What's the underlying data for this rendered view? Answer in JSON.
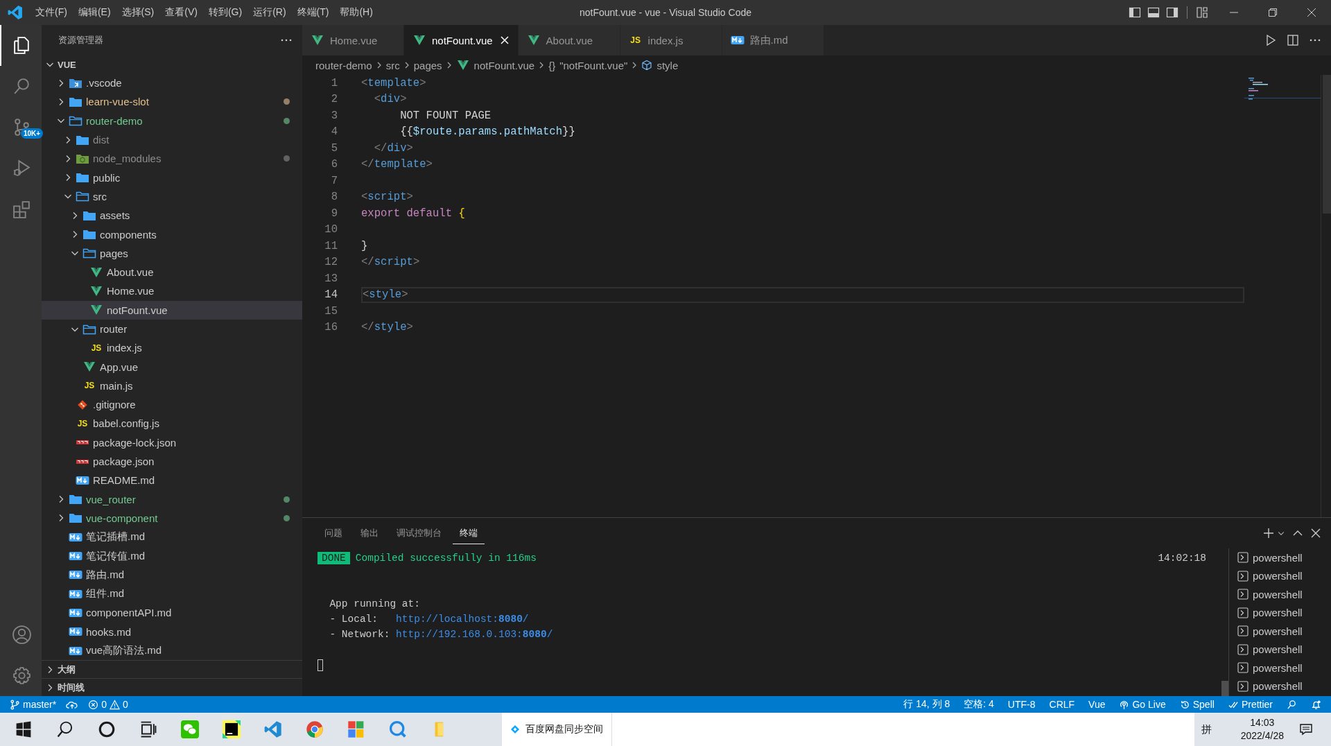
{
  "title_bar": {
    "menus": [
      "文件(F)",
      "编辑(E)",
      "选择(S)",
      "查看(V)",
      "转到(G)",
      "运行(R)",
      "终端(T)",
      "帮助(H)"
    ],
    "title": "notFount.vue - vue - Visual Studio Code"
  },
  "activity_bar": {
    "items": [
      {
        "kind": "explorer",
        "selected": true
      },
      {
        "kind": "search",
        "selected": false
      },
      {
        "kind": "source-control",
        "selected": false,
        "badge": "10K+"
      },
      {
        "kind": "run",
        "selected": false
      },
      {
        "kind": "extensions",
        "selected": false
      }
    ],
    "bottom": [
      {
        "kind": "account"
      },
      {
        "kind": "settings"
      }
    ]
  },
  "explorer": {
    "title": "资源管理器",
    "root": {
      "label": "VUE",
      "expanded": true
    },
    "tree": [
      {
        "name": ".vscode",
        "kind": "vscode-folder",
        "expanded": false,
        "selected": false
      },
      {
        "name": "learn-vue-slot",
        "kind": "folder",
        "expanded": false,
        "selected": false,
        "color": "#e2c08d",
        "dot": true
      },
      {
        "name": "router-demo",
        "kind": "folder",
        "expanded": true,
        "selected": false,
        "color": "#73c991",
        "dot": true,
        "children": [
          {
            "name": "dist",
            "kind": "folder",
            "expanded": false,
            "selected": false,
            "color": "#8c8c8c",
            "dot": false
          },
          {
            "name": "node_modules",
            "kind": "node-folder",
            "expanded": false,
            "selected": false,
            "color": "#8c8c8c",
            "dot": true
          },
          {
            "name": "public",
            "kind": "folder",
            "expanded": false,
            "selected": false
          },
          {
            "name": "src",
            "kind": "folder",
            "expanded": true,
            "selected": false,
            "children": [
              {
                "name": "assets",
                "kind": "folder",
                "expanded": false,
                "selected": false
              },
              {
                "name": "components",
                "kind": "folder",
                "expanded": false,
                "selected": false
              },
              {
                "name": "pages",
                "kind": "folder",
                "expanded": true,
                "selected": false,
                "children": [
                  {
                    "name": "About.vue",
                    "kind": "vue",
                    "selected": false
                  },
                  {
                    "name": "Home.vue",
                    "kind": "vue",
                    "selected": false
                  },
                  {
                    "name": "notFount.vue",
                    "kind": "vue",
                    "selected": true
                  }
                ]
              },
              {
                "name": "router",
                "kind": "folder",
                "expanded": true,
                "selected": false,
                "children": [
                  {
                    "name": "index.js",
                    "kind": "js",
                    "icon_label": "JS",
                    "selected": false
                  }
                ]
              },
              {
                "name": "App.vue",
                "kind": "vue",
                "selected": false
              },
              {
                "name": "main.js",
                "kind": "js",
                "icon_label": "JS",
                "selected": false
              }
            ]
          },
          {
            "name": ".gitignore",
            "kind": "git",
            "selected": false
          },
          {
            "name": "babel.config.js",
            "kind": "js",
            "icon_label": "JS",
            "selected": false
          },
          {
            "name": "package-lock.json",
            "kind": "npm",
            "selected": false
          },
          {
            "name": "package.json",
            "kind": "npm",
            "selected": false
          },
          {
            "name": "README.md",
            "kind": "md",
            "selected": false
          }
        ]
      },
      {
        "name": "vue_router",
        "kind": "folder",
        "expanded": false,
        "selected": false,
        "color": "#73c991",
        "dot": true
      },
      {
        "name": "vue-component",
        "kind": "folder",
        "expanded": false,
        "selected": false,
        "color": "#73c991",
        "dot": true
      },
      {
        "name": "笔记插槽.md",
        "kind": "md",
        "selected": false
      },
      {
        "name": "笔记传值.md",
        "kind": "md",
        "selected": false
      },
      {
        "name": "路由.md",
        "kind": "md",
        "selected": false
      },
      {
        "name": "组件.md",
        "kind": "md",
        "selected": false
      },
      {
        "name": "componentAPI.md",
        "kind": "md",
        "selected": false
      },
      {
        "name": "hooks.md",
        "kind": "md",
        "selected": false
      },
      {
        "name": "vue高阶语法.md",
        "kind": "md",
        "selected": false
      }
    ],
    "sections": [
      {
        "label": "大纲",
        "expanded": false
      },
      {
        "label": "时间线",
        "expanded": false
      }
    ]
  },
  "editor": {
    "tabs": [
      {
        "label": "Home.vue",
        "kind": "vue",
        "selected": false
      },
      {
        "label": "notFount.vue",
        "kind": "vue",
        "selected": true
      },
      {
        "label": "About.vue",
        "kind": "vue",
        "selected": false
      },
      {
        "label": "index.js",
        "kind": "js",
        "icon_label": "JS",
        "selected": false
      },
      {
        "label": "路由.md",
        "kind": "md",
        "selected": false
      }
    ],
    "breadcrumb": [
      {
        "kind": "folder",
        "text": "router-demo"
      },
      {
        "kind": "folder",
        "text": "src"
      },
      {
        "kind": "folder",
        "text": "pages"
      },
      {
        "kind": "file",
        "text": "notFount.vue"
      },
      {
        "kind": "object",
        "symbol": "{}",
        "text": "\"notFount.vue\""
      },
      {
        "kind": "element",
        "text": "style"
      }
    ],
    "lines": [
      {
        "number": "1",
        "current": false,
        "tokens": [
          {
            "kind": "punct",
            "text": "<"
          },
          {
            "kind": "tag",
            "text": "template"
          },
          {
            "kind": "punct",
            "text": ">"
          }
        ]
      },
      {
        "number": "2",
        "current": false,
        "tokens": [
          {
            "kind": "punct",
            "text": "  <"
          },
          {
            "kind": "tag",
            "text": "div"
          },
          {
            "kind": "punct",
            "text": ">"
          }
        ]
      },
      {
        "number": "3",
        "current": false,
        "tokens": [
          {
            "kind": "text",
            "text": "      NOT FOUNT PAGE"
          }
        ]
      },
      {
        "number": "4",
        "current": false,
        "tokens": [
          {
            "kind": "text",
            "text": "      {{"
          },
          {
            "kind": "variable",
            "text": "$route.params.pathMatch"
          },
          {
            "kind": "text",
            "text": "}}"
          }
        ]
      },
      {
        "number": "5",
        "current": false,
        "tokens": [
          {
            "kind": "punct",
            "text": "  </"
          },
          {
            "kind": "tag",
            "text": "div"
          },
          {
            "kind": "punct",
            "text": ">"
          }
        ]
      },
      {
        "number": "6",
        "current": false,
        "tokens": [
          {
            "kind": "punct",
            "text": "</"
          },
          {
            "kind": "tag",
            "text": "template"
          },
          {
            "kind": "punct",
            "text": ">"
          }
        ]
      },
      {
        "number": "7",
        "current": false
      },
      {
        "number": "8",
        "current": false,
        "tokens": [
          {
            "kind": "punct",
            "text": "<"
          },
          {
            "kind": "tag",
            "text": "script"
          },
          {
            "kind": "punct",
            "text": ">"
          }
        ]
      },
      {
        "number": "9",
        "current": false,
        "tokens": [
          {
            "kind": "keyword",
            "text": "export default "
          },
          {
            "kind": "bracket",
            "text": "{"
          }
        ]
      },
      {
        "number": "10",
        "current": false
      },
      {
        "number": "11",
        "current": false,
        "tokens": [
          {
            "kind": "text",
            "text": "}"
          }
        ]
      },
      {
        "number": "12",
        "current": false,
        "tokens": [
          {
            "kind": "punct",
            "text": "</"
          },
          {
            "kind": "tag",
            "text": "script"
          },
          {
            "kind": "punct",
            "text": ">"
          }
        ]
      },
      {
        "number": "13",
        "current": false
      },
      {
        "number": "14",
        "current": true,
        "tokens": [
          {
            "kind": "punct",
            "text": "<"
          },
          {
            "kind": "tag",
            "text": "style"
          },
          {
            "kind": "punct",
            "text": ">"
          }
        ]
      },
      {
        "number": "15",
        "current": false
      },
      {
        "number": "16",
        "current": false,
        "tokens": [
          {
            "kind": "punct",
            "text": "</"
          },
          {
            "kind": "tag",
            "text": "style"
          },
          {
            "kind": "punct",
            "text": ">"
          }
        ]
      }
    ]
  },
  "panel": {
    "tabs": [
      {
        "label": "问题",
        "selected": false
      },
      {
        "label": "输出",
        "selected": false
      },
      {
        "label": "调试控制台",
        "selected": false
      },
      {
        "label": "终端",
        "selected": true
      }
    ],
    "terminal": [
      {
        "kind": "status",
        "badge": "DONE",
        "text": "Compiled successfully in 116ms",
        "time": "14:02:18"
      },
      {
        "kind": "blank"
      },
      {
        "kind": "blank"
      },
      {
        "kind": "text",
        "text": "App running at:"
      },
      {
        "kind": "url",
        "label": "- Local:",
        "url": "http://localhost:**8080**/"
      },
      {
        "kind": "url",
        "label": "- Network:",
        "url": "http://192.168.0.103:**8080**/"
      },
      {
        "kind": "blank"
      },
      {
        "kind": "cursor"
      }
    ],
    "terminals": [
      "powershell",
      "powershell",
      "powershell",
      "powershell",
      "powershell",
      "powershell",
      "powershell",
      "powershell"
    ]
  },
  "status_bar": {
    "left": [
      {
        "kind": "branch",
        "text": "master*"
      },
      {
        "kind": "sync"
      },
      {
        "kind": "problems",
        "errors": "0",
        "warnings": "0"
      }
    ],
    "right": [
      {
        "kind": "text",
        "text": "行 14, 列 8"
      },
      {
        "kind": "text",
        "text": "空格: 4"
      },
      {
        "kind": "text",
        "text": "UTF-8"
      },
      {
        "kind": "text",
        "text": "CRLF"
      },
      {
        "kind": "text",
        "text": "Vue"
      },
      {
        "kind": "golive",
        "text": "Go Live"
      },
      {
        "kind": "spell",
        "text": "Spell"
      },
      {
        "kind": "prettier",
        "text": "Prettier"
      },
      {
        "kind": "feedback"
      },
      {
        "kind": "bell"
      }
    ]
  },
  "taskbar": {
    "apps": [
      {
        "kind": "start"
      },
      {
        "kind": "search"
      },
      {
        "kind": "cortana"
      },
      {
        "kind": "task-view"
      },
      {
        "kind": "chat"
      },
      {
        "kind": "ide"
      },
      {
        "kind": "editor"
      },
      {
        "kind": "browser"
      },
      {
        "kind": "tiles"
      },
      {
        "kind": "bubble"
      },
      {
        "kind": "folder"
      }
    ],
    "window_preview": "百度网盘同步空间",
    "ime": "拼",
    "time": "14:03",
    "date": "2022/4/28"
  }
}
